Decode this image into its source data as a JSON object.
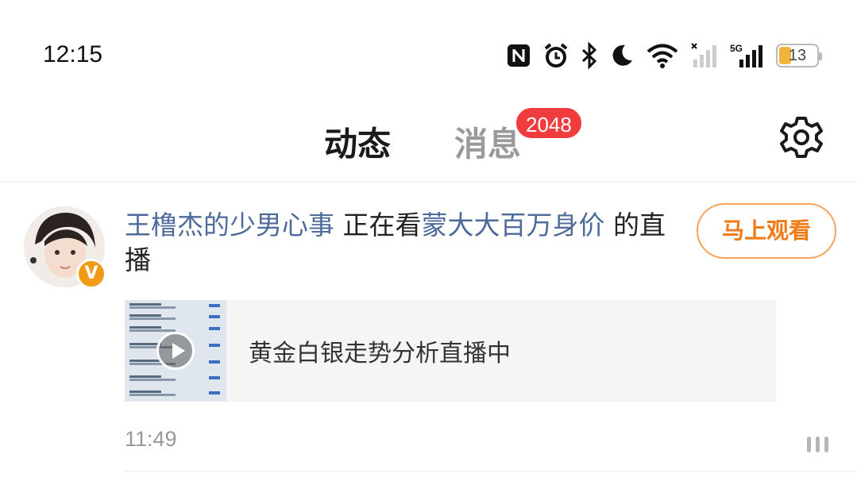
{
  "status_bar": {
    "time": "12:15",
    "icons": [
      "nfc-icon",
      "alarm-icon",
      "bluetooth-icon",
      "do-not-disturb-icon",
      "wifi-icon",
      "signal-off-icon",
      "5g-signal-icon"
    ],
    "network_label": "5G",
    "battery_level": "13",
    "battery_color": "#f0b43a"
  },
  "header": {
    "tabs": [
      {
        "label": "动态",
        "active": true
      },
      {
        "label": "消息",
        "active": false
      }
    ],
    "messages_badge": "2048",
    "accent_color": "#ffb21e",
    "badge_color": "#f03c3c"
  },
  "feed": {
    "item": {
      "user_name": "王橹杰的少男心事",
      "verb": " 正在看",
      "host_name": "蒙大大百万身价",
      "suffix": " 的直播",
      "avatar_badge": "V",
      "watch_button": "马上观看",
      "live_title": "黄金白银走势分析直播中",
      "time": "11:49"
    }
  }
}
